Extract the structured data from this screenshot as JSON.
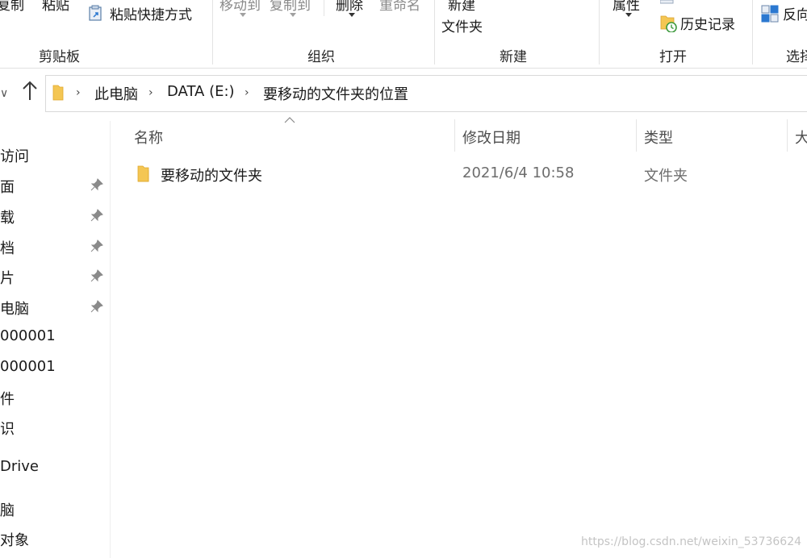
{
  "ribbon": {
    "clipboard": {
      "copy_label": "复制",
      "paste_label": "粘贴",
      "paste_shortcut_label": "粘贴快捷方式",
      "group_label": "剪贴板"
    },
    "organize": {
      "move_to_label": "移动到",
      "copy_to_label": "复制到",
      "delete_label": "删除",
      "rename_label": "重命名",
      "group_label": "组织"
    },
    "new": {
      "new_folder_line1": "新建",
      "new_folder_line2": "文件夹",
      "group_label": "新建"
    },
    "open": {
      "properties_label": "属性",
      "history_label": "历史记录",
      "group_label": "打开"
    },
    "select": {
      "invert_label": "反向",
      "group_label": "选择"
    }
  },
  "address_bar": {
    "crumbs": [
      "此电脑",
      "DATA (E:)",
      "要移动的文件夹的位置"
    ]
  },
  "nav_pane": {
    "items": [
      {
        "label": "访问",
        "pinned": false
      },
      {
        "label": "面",
        "pinned": true
      },
      {
        "label": "载",
        "pinned": true
      },
      {
        "label": "档",
        "pinned": true
      },
      {
        "label": "片",
        "pinned": true
      },
      {
        "label": "电脑",
        "pinned": true
      },
      {
        "label": "000001",
        "pinned": false
      },
      {
        "label": "000001",
        "pinned": false
      },
      {
        "label": "件",
        "pinned": false
      },
      {
        "label": "识",
        "pinned": false
      },
      {
        "label": "Drive",
        "pinned": false
      },
      {
        "label": "脑",
        "pinned": false
      },
      {
        "label": "对象",
        "pinned": false
      }
    ]
  },
  "file_list": {
    "columns": [
      "名称",
      "修改日期",
      "类型",
      "大"
    ],
    "rows": [
      {
        "name": "要移动的文件夹",
        "modified": "2021/6/4 10:58",
        "type": "文件夹"
      }
    ]
  },
  "watermark": "https://blog.csdn.net/weixin_53736624",
  "colors": {
    "folder_yellow": "#f4c653",
    "folder_shadow": "#e0a82e",
    "accent_blue": "#2b78d0"
  }
}
